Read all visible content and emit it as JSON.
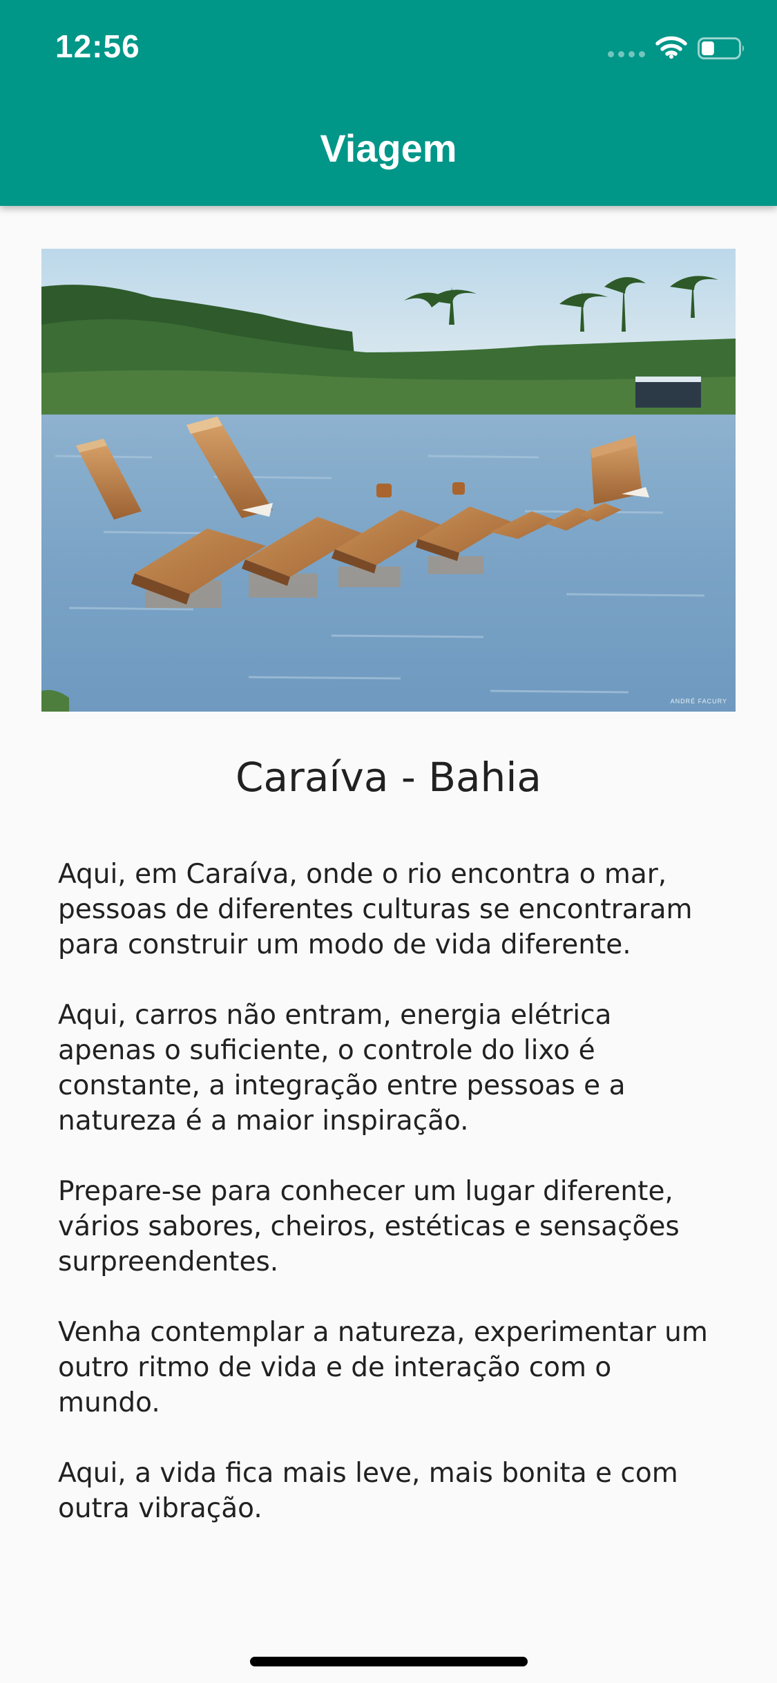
{
  "status_bar": {
    "time": "12:56",
    "wifi_icon": "wifi-icon",
    "battery_icon": "battery-icon",
    "battery_level": 0.35
  },
  "app_bar": {
    "title": "Viagem",
    "color": "#009688"
  },
  "hero_image": {
    "credit": "ANDRÉ FACURY",
    "subject": "wooden posts in river water with palm trees"
  },
  "place": {
    "title": "Caraíva - Bahia"
  },
  "description": {
    "paragraphs": [
      "Aqui, em Caraíva, onde o rio encontra o mar,\npessoas de diferentes culturas se encontraram\npara construir um modo de vida diferente.",
      "Aqui, carros não entram, energia elétrica\napenas o suficiente, o controle do lixo é\nconstante, a integração entre pessoas e a\nnatureza é a maior inspiração.",
      "Prepare-se para conhecer um lugar diferente,\nvários sabores, cheiros, estéticas e sensações\nsurpreendentes.",
      "Venha contemplar a natureza, experimentar um\noutro ritmo de vida e de interação com o\nmundo.",
      "Aqui, a vida fica mais leve, mais bonita e com\noutra vibração."
    ]
  }
}
